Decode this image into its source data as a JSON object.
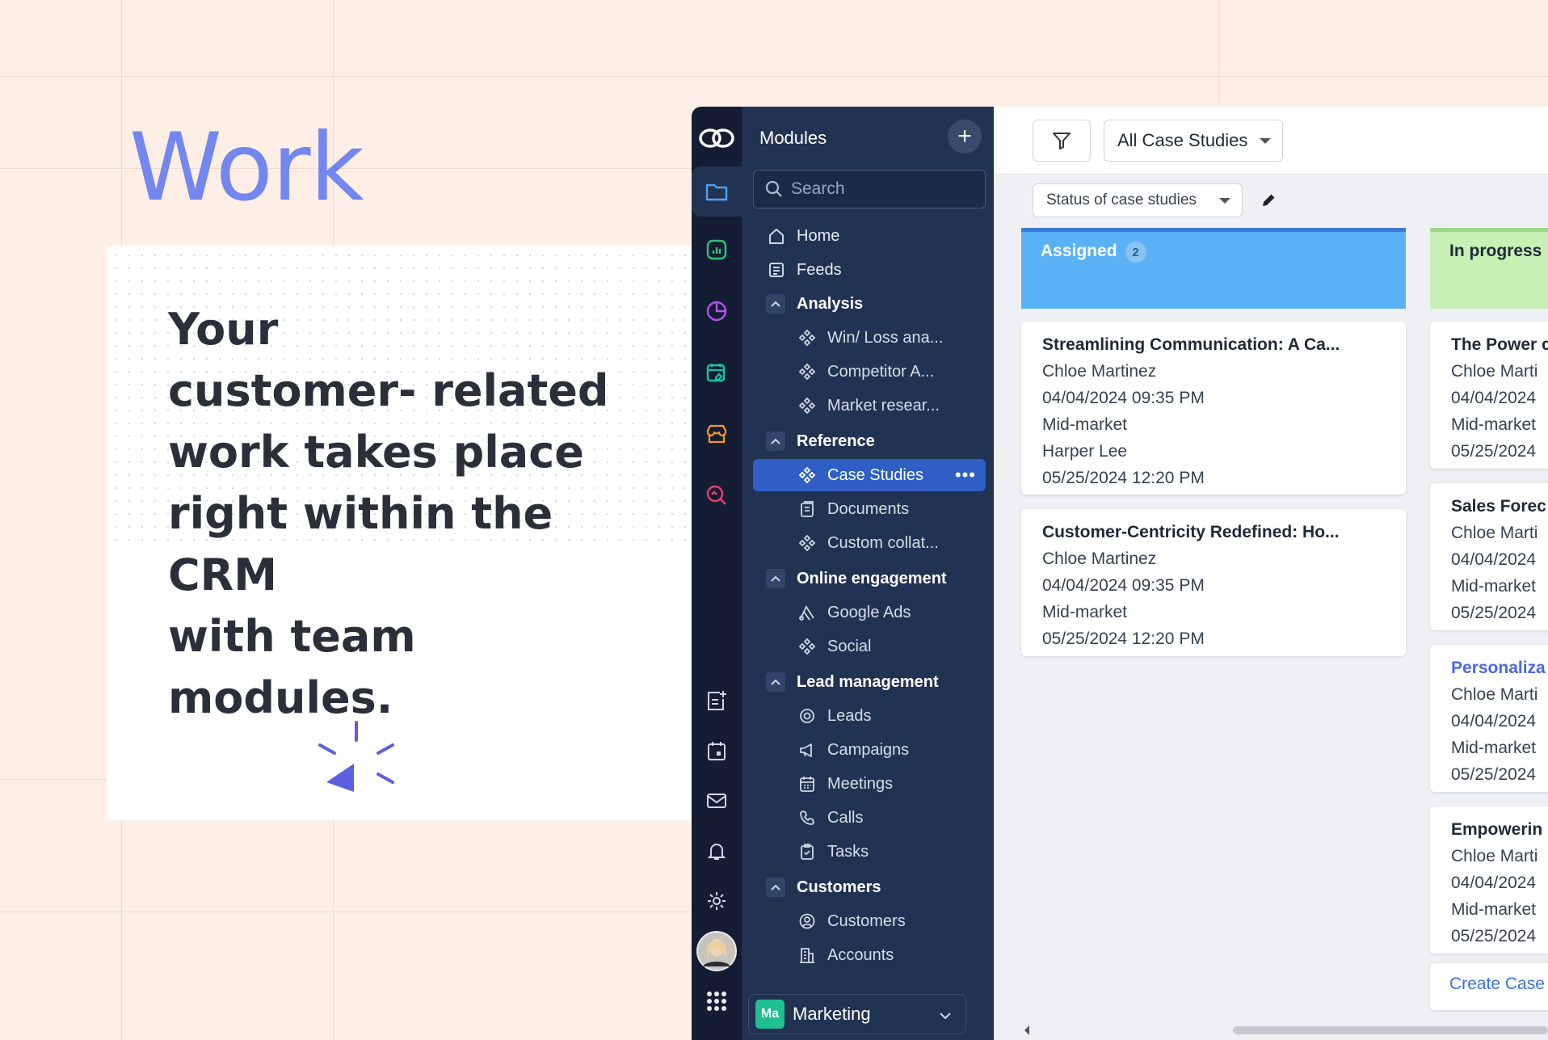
{
  "hero": {
    "title": "Work",
    "tagline_lines": [
      "Your",
      "customer- related",
      "work takes place",
      "right within the CRM",
      "with team modules."
    ]
  },
  "sidebar": {
    "header": "Modules",
    "add_label": "+",
    "search_placeholder": "Search",
    "items": {
      "home": "Home",
      "feeds": "Feeds",
      "analysis": "Analysis",
      "win_loss": "Win/ Loss ana...",
      "competitor": "Competitor A...",
      "market": "Market resear...",
      "reference": "Reference",
      "case_studies": "Case Studies",
      "documents": "Documents",
      "custom_collat": "Custom collat...",
      "online_engagement": "Online engagement",
      "google_ads": "Google Ads",
      "social": "Social",
      "lead_management": "Lead management",
      "leads": "Leads",
      "campaigns": "Campaigns",
      "meetings": "Meetings",
      "calls": "Calls",
      "tasks": "Tasks",
      "customers_group": "Customers",
      "customers": "Customers",
      "accounts": "Accounts"
    },
    "more_label": "•••",
    "team": {
      "initials": "Ma",
      "name": "Marketing"
    }
  },
  "toolbar": {
    "view_select": "All Case Studies",
    "status_select": "Status of case studies"
  },
  "board": {
    "assigned": {
      "label": "Assigned",
      "count": "2",
      "color": "#5bb1f5",
      "cards": [
        {
          "title": "Streamlining Communication: A Ca...",
          "l1": "Chloe Martinez",
          "l2": "04/04/2024 09:35 PM",
          "l3": "Mid-market",
          "l4": "Harper Lee",
          "l5": "05/25/2024 12:20 PM"
        },
        {
          "title": "Customer-Centricity Redefined: Ho...",
          "l1": "Chloe Martinez",
          "l2": "04/04/2024 09:35 PM",
          "l3": "Mid-market",
          "l4": "05/25/2024 12:20 PM"
        }
      ]
    },
    "in_progress": {
      "label": "In progress",
      "color": "#c7efb6",
      "cards": [
        {
          "title": "The Power c",
          "l1": "Chloe Marti",
          "l2": "04/04/2024",
          "l3": "Mid-market",
          "l4": "05/25/2024"
        },
        {
          "title": "Sales Forec",
          "l1": "Chloe Marti",
          "l2": "04/04/2024",
          "l3": "Mid-market",
          "l4": "05/25/2024"
        },
        {
          "title": "Personaliza",
          "l1": "Chloe Marti",
          "l2": "04/04/2024",
          "l3": "Mid-market",
          "l4": "05/25/2024"
        },
        {
          "title": "Empowerin",
          "l1": "Chloe Marti",
          "l2": "04/04/2024",
          "l3": "Mid-market",
          "l4": "05/25/2024"
        }
      ],
      "create_label": "Create Case"
    }
  },
  "colors": {
    "accent": "#7287f0",
    "sidebar": "#223252",
    "rail": "#141d33",
    "selected": "#2f5fc4",
    "link": "#4a67e6"
  }
}
